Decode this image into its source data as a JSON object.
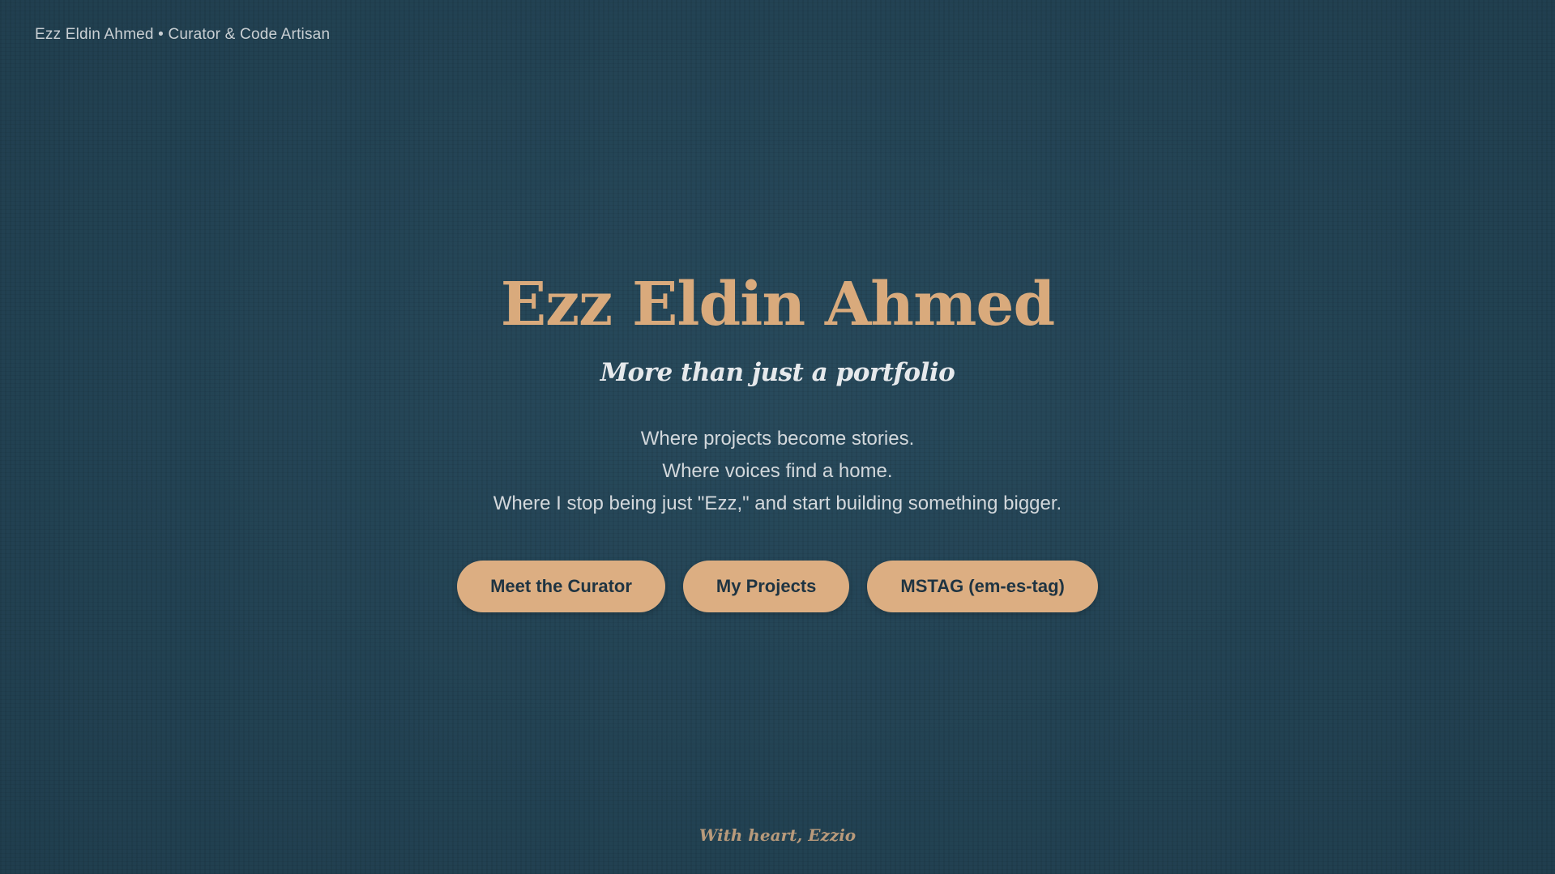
{
  "header": {
    "site_label": "Ezz Eldin Ahmed • Curator & Code Artisan"
  },
  "hero": {
    "title": "Ezz Eldin Ahmed",
    "subtitle": "More than just a portfolio",
    "tagline_lines": [
      "Where projects become stories.",
      "Where voices find a home.",
      "Where I stop being just \"Ezz,\" and start building something bigger."
    ]
  },
  "buttons": [
    {
      "label": "Meet the Curator"
    },
    {
      "label": "My Projects"
    },
    {
      "label": "MSTAG (em-es-tag)"
    }
  ],
  "footer": {
    "signature": "With heart, Ezzio"
  },
  "colors": {
    "background": "#234354",
    "accent": "#dcae82",
    "title": "#d9aa7c",
    "text": "#d3d8dc"
  }
}
